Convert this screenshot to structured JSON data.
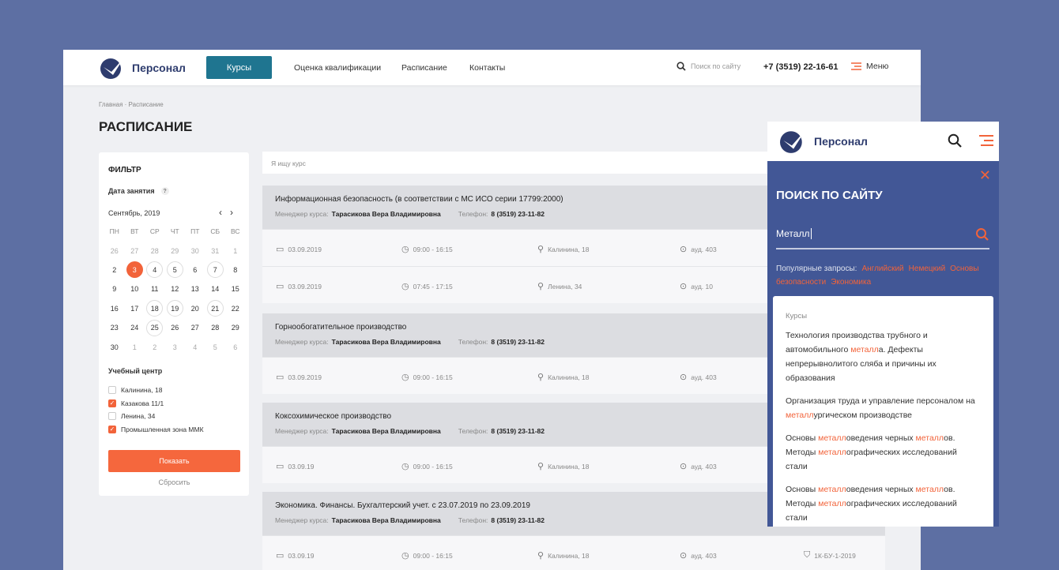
{
  "header": {
    "brand": "Персонал",
    "nav": [
      {
        "label": "Курсы",
        "active": true
      },
      {
        "label": "Оценка квалификации"
      },
      {
        "label": "Расписание"
      },
      {
        "label": "Контакты"
      }
    ],
    "search_placeholder": "Поиск по сайту",
    "phone": "+7 (3519) 22-16-61",
    "menu": "Меню"
  },
  "breadcrumb": "Главная · Расписание",
  "title": "РАСПИСАНИЕ",
  "filter": {
    "heading": "ФИЛЬТР",
    "date_label": "Дата занятия",
    "help": "?",
    "month": "Сентябрь, 2019",
    "prev": "‹",
    "next": "›",
    "weekdays": [
      "ПН",
      "ВТ",
      "СР",
      "ЧТ",
      "ПТ",
      "СБ",
      "ВС"
    ],
    "days": [
      {
        "d": "26",
        "m": 1
      },
      {
        "d": "27",
        "m": 1
      },
      {
        "d": "28",
        "m": 1
      },
      {
        "d": "29",
        "m": 1
      },
      {
        "d": "30",
        "m": 1
      },
      {
        "d": "31",
        "m": 1
      },
      {
        "d": "1",
        "m": 1
      },
      {
        "d": "2"
      },
      {
        "d": "3",
        "s": 1
      },
      {
        "d": "4",
        "r": 1
      },
      {
        "d": "5",
        "r": 1
      },
      {
        "d": "6"
      },
      {
        "d": "7",
        "r": 1
      },
      {
        "d": "8"
      },
      {
        "d": "9"
      },
      {
        "d": "10"
      },
      {
        "d": "11"
      },
      {
        "d": "12"
      },
      {
        "d": "13"
      },
      {
        "d": "14"
      },
      {
        "d": "15"
      },
      {
        "d": "16"
      },
      {
        "d": "17"
      },
      {
        "d": "18",
        "r": 1
      },
      {
        "d": "19",
        "r": 1
      },
      {
        "d": "20"
      },
      {
        "d": "21",
        "r": 1
      },
      {
        "d": "22"
      },
      {
        "d": "23"
      },
      {
        "d": "24"
      },
      {
        "d": "25",
        "r": 1
      },
      {
        "d": "26"
      },
      {
        "d": "27"
      },
      {
        "d": "28"
      },
      {
        "d": "29"
      },
      {
        "d": "30"
      },
      {
        "d": "1",
        "m": 1
      },
      {
        "d": "2",
        "m": 1
      },
      {
        "d": "3",
        "m": 1
      },
      {
        "d": "4",
        "m": 1
      },
      {
        "d": "5",
        "m": 1
      },
      {
        "d": "6",
        "m": 1
      }
    ],
    "center_label": "Учебный центр",
    "centers": [
      {
        "label": "Калинина, 18",
        "checked": false
      },
      {
        "label": "Казакова 11/1",
        "checked": true
      },
      {
        "label": "Ленина, 34",
        "checked": false
      },
      {
        "label": "Промышленная зона ММК",
        "checked": true
      }
    ],
    "show": "Показать",
    "reset": "Сбросить"
  },
  "course_search_placeholder": "Я ищу курс",
  "courses": [
    {
      "title": "Информационная безопасность (в соответствии с МС ИСО серии 17799:2000)",
      "manager_label": "Менеджер курса:",
      "manager": "Тарасикова Вера Владимировна",
      "phone_label": "Телефон:",
      "phone": "8 (3519) 23-11-82",
      "sessions": [
        {
          "date": "03.09.2019",
          "time": "09:00 - 16:15",
          "place": "Калинина, 18",
          "room": "ауд. 403"
        },
        {
          "date": "03.09.2019",
          "time": "07:45 - 17:15",
          "place": "Ленина, 34",
          "room": "ауд. 10"
        }
      ]
    },
    {
      "title": "Горнообогатительное производство",
      "manager_label": "Менеджер курса:",
      "manager": "Тарасикова Вера Владимировна",
      "phone_label": "Телефон:",
      "phone": "8 (3519) 23-11-82",
      "sessions": [
        {
          "date": "03.09.2019",
          "time": "09:00 - 16:15",
          "place": "Калинина, 18",
          "room": "ауд. 403"
        }
      ]
    },
    {
      "title": "Коксохимическое производство",
      "manager_label": "Менеджер курса:",
      "manager": "Тарасикова Вера Владимировна",
      "phone_label": "Телефон:",
      "phone": "8 (3519) 23-11-82",
      "sessions": [
        {
          "date": "03.09.19",
          "time": "09:00 - 16:15",
          "place": "Калинина, 18",
          "room": "ауд. 403"
        }
      ]
    },
    {
      "title": "Экономика. Финансы. Бухгалтерский учет. с 23.07.2019 по 23.09.2019",
      "manager_label": "Менеджер курса:",
      "manager": "Тарасикова Вера Владимировна",
      "phone_label": "Телефон:",
      "phone": "8 (3519) 23-11-82",
      "sessions": [
        {
          "date": "03.09.19",
          "time": "09:00 - 16:15",
          "place": "Калинина, 18",
          "room": "ауд. 403",
          "group": "1К-БУ-1-2019"
        }
      ]
    }
  ],
  "mobile": {
    "brand": "Персонал",
    "title": "ПОИСК ПО САЙТУ",
    "query": "Металл",
    "popular_label": "Популярные запросы:",
    "popular": [
      "Английский",
      "Немецкий",
      "Основы безопасности",
      "Экономика"
    ],
    "results_heading": "Курсы",
    "results": [
      [
        {
          "t": "Технология производства трубного и автомобильного "
        },
        {
          "t": "металл",
          "hl": true
        },
        {
          "t": "а. Дефекты непрерывнолитого сляба и причины их образования"
        }
      ],
      [
        {
          "t": "Организация труда и управление персоналом на "
        },
        {
          "t": "металл",
          "hl": true
        },
        {
          "t": "ургическом производстве"
        }
      ],
      [
        {
          "t": "Основы "
        },
        {
          "t": "металл",
          "hl": true
        },
        {
          "t": "оведения черных "
        },
        {
          "t": "металл",
          "hl": true
        },
        {
          "t": "ов. Методы "
        },
        {
          "t": "металл",
          "hl": true
        },
        {
          "t": "ографических исследований стали"
        }
      ],
      [
        {
          "t": "Основы "
        },
        {
          "t": "металл",
          "hl": true
        },
        {
          "t": "оведения черных "
        },
        {
          "t": "металл",
          "hl": true
        },
        {
          "t": "ов. Методы "
        },
        {
          "t": "металл",
          "hl": true
        },
        {
          "t": "ографических исследований стали"
        }
      ]
    ]
  },
  "colors": {
    "accent": "#f2633a",
    "nav_active": "#1f7590",
    "bg": "#5d6fa3",
    "mobile_bg": "#425796"
  }
}
